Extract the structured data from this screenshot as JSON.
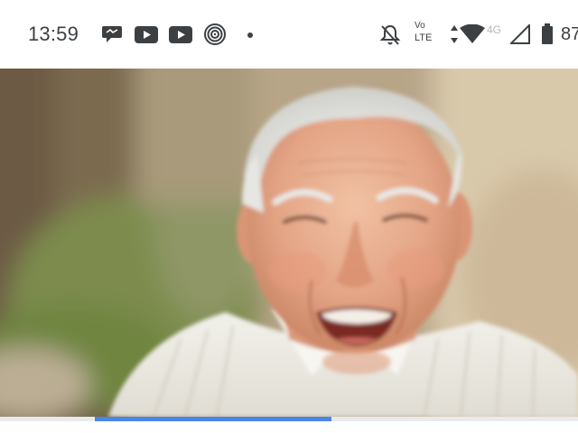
{
  "status_bar": {
    "time": "13:59",
    "notification_icons": [
      "chat-bubble-icon",
      "youtube-icon",
      "youtube-icon",
      "podcast-icon",
      "more-notifications-dot-icon"
    ],
    "system_icons": [
      "bell-off-icon",
      "volte-icon",
      "data-arrows-icon",
      "wifi-icon",
      "cellular-signal-icon",
      "battery-icon"
    ],
    "volte_line1": "Vo",
    "volte_line2": "LTE",
    "network_type": "4G",
    "battery_percent": "87"
  },
  "media": {
    "image": "photo of a smiling elderly man with white hair in a striped shirt",
    "progress": 0.41,
    "colors": {
      "progress_fill": "#4a86e8",
      "progress_track": "#e8eaed"
    }
  }
}
